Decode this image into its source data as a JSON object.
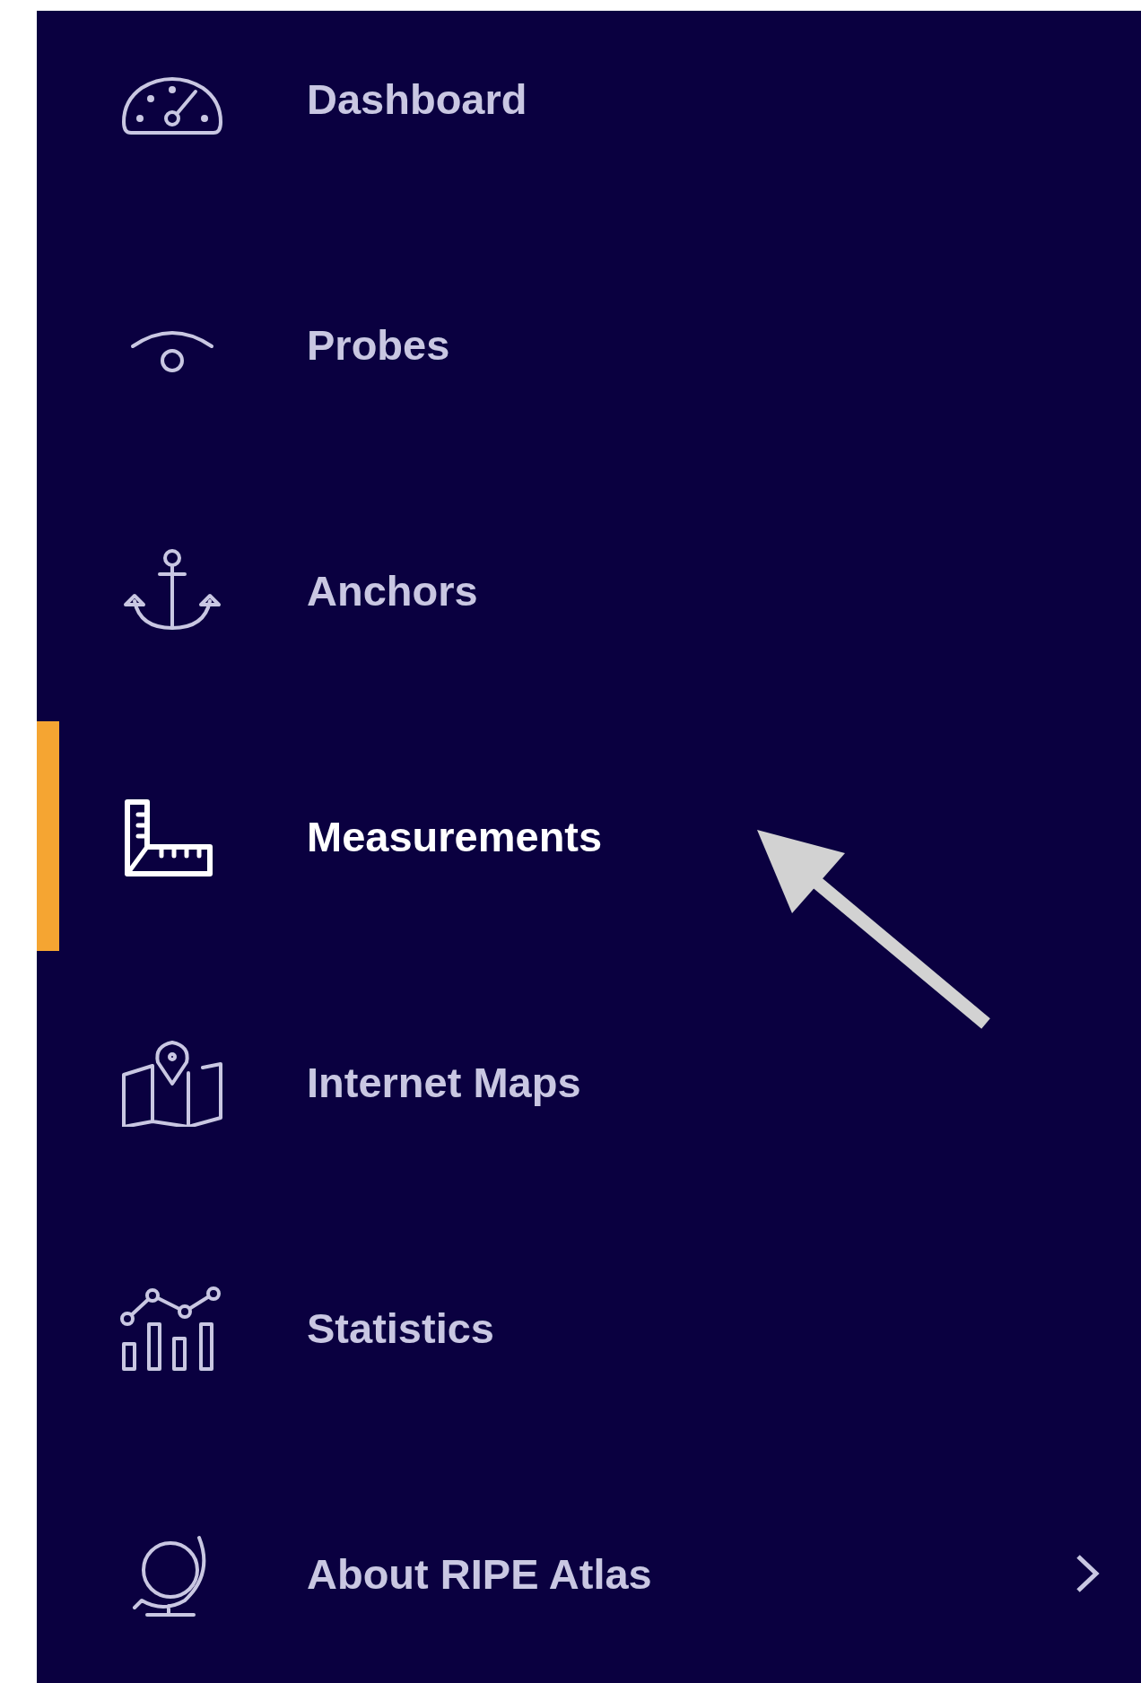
{
  "sidebar": {
    "items": [
      {
        "kind": "dashboard",
        "label": "Dashboard",
        "selected": false,
        "submenu": false
      },
      {
        "kind": "probe",
        "label": "Probes",
        "selected": false,
        "submenu": false
      },
      {
        "kind": "anchor",
        "label": "Anchors",
        "selected": false,
        "submenu": false
      },
      {
        "kind": "ruler",
        "label": "Measurements",
        "selected": true,
        "submenu": false
      },
      {
        "kind": "map",
        "label": "Internet Maps",
        "selected": false,
        "submenu": false
      },
      {
        "kind": "stats",
        "label": "Statistics",
        "selected": false,
        "submenu": false
      },
      {
        "kind": "globe",
        "label": "About RIPE Atlas",
        "selected": false,
        "submenu": true
      }
    ]
  }
}
